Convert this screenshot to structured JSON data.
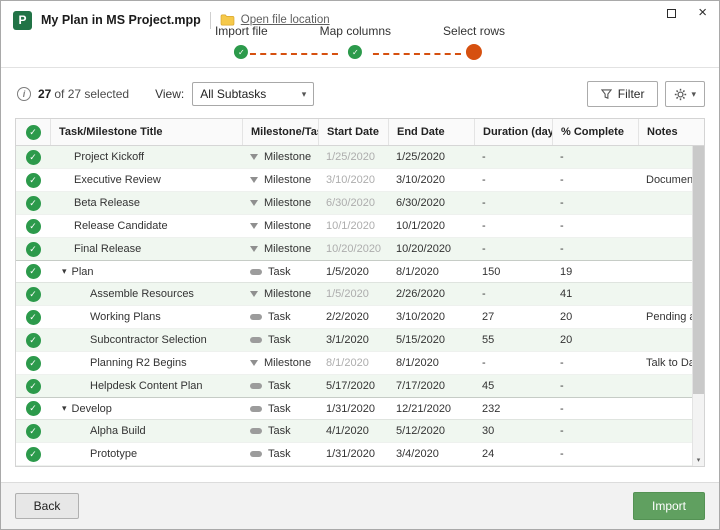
{
  "window": {
    "title": "My Plan in MS Project.mpp",
    "app_icon_letter": "P",
    "open_file_location_label": "Open file location"
  },
  "stepper": {
    "steps": [
      {
        "label": "Import file",
        "state": "done"
      },
      {
        "label": "Map columns",
        "state": "done"
      },
      {
        "label": "Select rows",
        "state": "active"
      }
    ]
  },
  "toolbar": {
    "selected_count": "27",
    "selected_suffix": "of 27 selected",
    "view_label": "View:",
    "view_value": "All Subtasks",
    "filter_label": "Filter"
  },
  "table": {
    "columns": [
      "Task/Milestone Title",
      "Milestone/Task",
      "Start Date",
      "End Date",
      "Duration (days)",
      "% Complete",
      "Notes"
    ],
    "rows": [
      {
        "title": "Project Kickoff",
        "type": "Milestone",
        "start": "1/25/2020",
        "end": "1/25/2020",
        "duration": "-",
        "complete": "-",
        "notes": "",
        "level": 1,
        "group": false
      },
      {
        "title": "Executive Review",
        "type": "Milestone",
        "start": "3/10/2020",
        "end": "3/10/2020",
        "duration": "-",
        "complete": "-",
        "notes": "Documentati...",
        "level": 1,
        "group": false
      },
      {
        "title": "Beta Release",
        "type": "Milestone",
        "start": "6/30/2020",
        "end": "6/30/2020",
        "duration": "-",
        "complete": "-",
        "notes": "",
        "level": 1,
        "group": false
      },
      {
        "title": "Release Candidate",
        "type": "Milestone",
        "start": "10/1/2020",
        "end": "10/1/2020",
        "duration": "-",
        "complete": "-",
        "notes": "",
        "level": 1,
        "group": false
      },
      {
        "title": "Final Release",
        "type": "Milestone",
        "start": "10/20/2020",
        "end": "10/20/2020",
        "duration": "-",
        "complete": "-",
        "notes": "",
        "level": 1,
        "group": false
      },
      {
        "title": "Plan",
        "type": "Task",
        "start": "1/5/2020",
        "end": "8/1/2020",
        "duration": "150",
        "complete": "19",
        "notes": "",
        "level": 1,
        "group": true
      },
      {
        "title": "Assemble Resources",
        "type": "Milestone",
        "start": "1/5/2020",
        "end": "2/26/2020",
        "duration": "-",
        "complete": "41",
        "notes": "",
        "level": 2,
        "group": false
      },
      {
        "title": "Working Plans",
        "type": "Task",
        "start": "2/2/2020",
        "end": "3/10/2020",
        "duration": "27",
        "complete": "20",
        "notes": "Pending app...",
        "level": 2,
        "group": false
      },
      {
        "title": "Subcontractor Selection",
        "type": "Task",
        "start": "3/1/2020",
        "end": "5/15/2020",
        "duration": "55",
        "complete": "20",
        "notes": "",
        "level": 2,
        "group": false
      },
      {
        "title": "Planning R2 Begins",
        "type": "Milestone",
        "start": "8/1/2020",
        "end": "8/1/2020",
        "duration": "-",
        "complete": "-",
        "notes": "Talk to Dan a...",
        "level": 2,
        "group": false
      },
      {
        "title": "Helpdesk Content Plan",
        "type": "Task",
        "start": "5/17/2020",
        "end": "7/17/2020",
        "duration": "45",
        "complete": "-",
        "notes": "",
        "level": 2,
        "group": false
      },
      {
        "title": "Develop",
        "type": "Task",
        "start": "1/31/2020",
        "end": "12/21/2020",
        "duration": "232",
        "complete": "-",
        "notes": "",
        "level": 1,
        "group": true
      },
      {
        "title": "Alpha Build",
        "type": "Task",
        "start": "4/1/2020",
        "end": "5/12/2020",
        "duration": "30",
        "complete": "-",
        "notes": "",
        "level": 2,
        "group": false
      },
      {
        "title": "Prototype",
        "type": "Task",
        "start": "1/31/2020",
        "end": "3/4/2020",
        "duration": "24",
        "complete": "-",
        "notes": "",
        "level": 2,
        "group": false
      }
    ]
  },
  "footer": {
    "back_label": "Back",
    "import_label": "Import"
  },
  "icons": {
    "check": "✓",
    "chevron_down": "▾",
    "caret_down": "▾",
    "scroll_down": "▾",
    "close": "×",
    "info": "i"
  },
  "colors": {
    "accent_green": "#2c9a4b",
    "step_active_orange": "#d6500f",
    "project_icon_green": "#217346",
    "import_button_green": "#60a060",
    "row_stripe_green": "#f0f7f0"
  }
}
